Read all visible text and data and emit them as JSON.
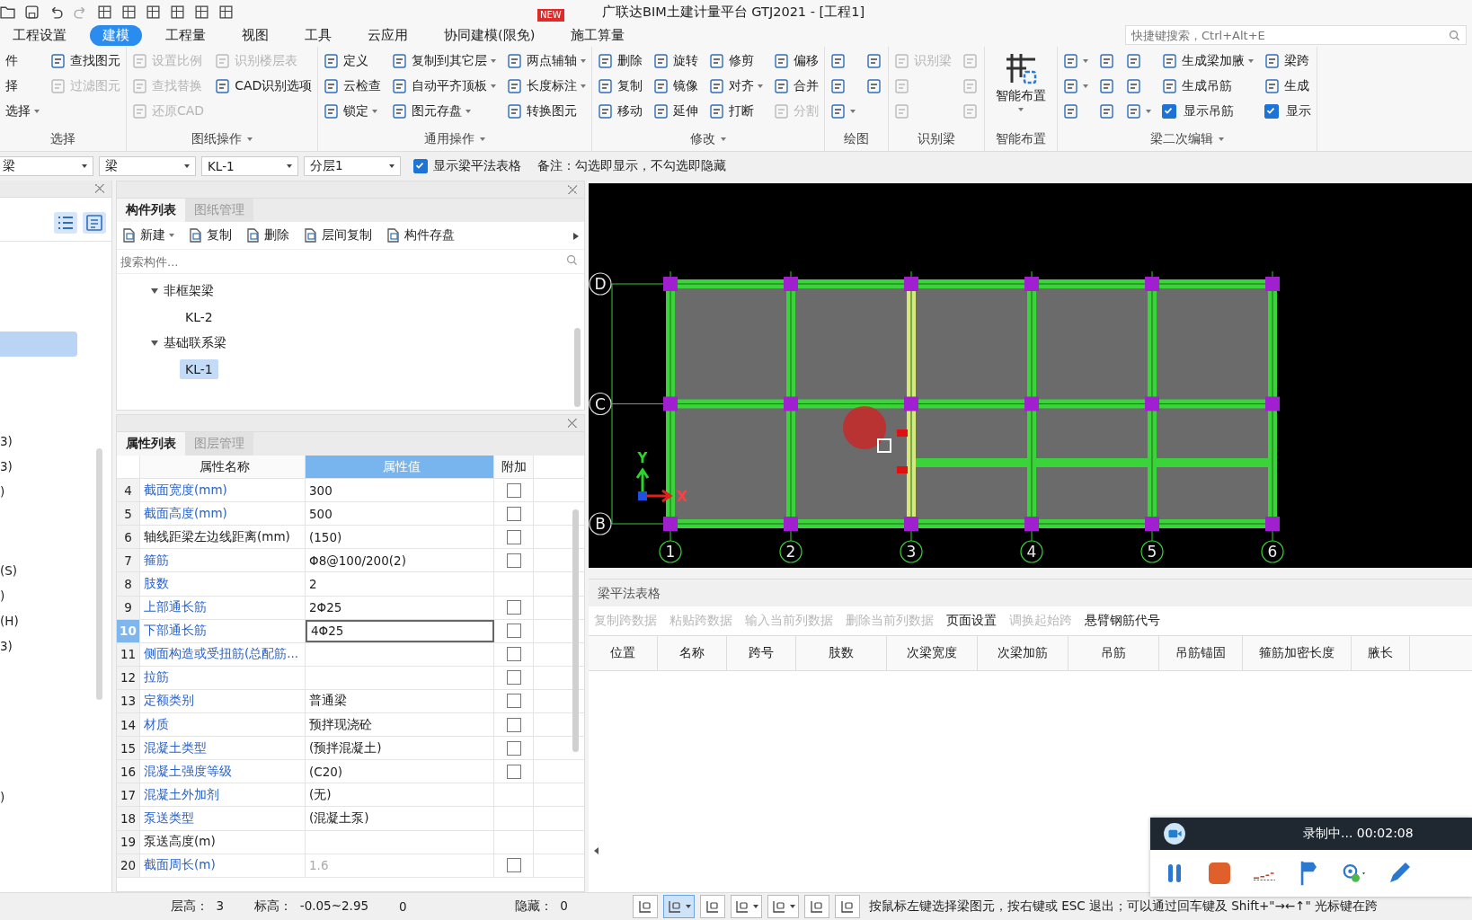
{
  "window": {
    "title": "广联达BIM土建计量平台 GTJ2021 - [工程1]",
    "badge": "NEW"
  },
  "menu_tabs": [
    {
      "label": "工程设置",
      "selected": false
    },
    {
      "label": "建模",
      "selected": true
    },
    {
      "label": "工程量",
      "selected": false
    },
    {
      "label": "视图",
      "selected": false
    },
    {
      "label": "工具",
      "selected": false
    },
    {
      "label": "云应用",
      "selected": false
    },
    {
      "label": "协同建模(限免)",
      "selected": false
    },
    {
      "label": "施工算量",
      "selected": false
    }
  ],
  "search": {
    "placeholder": "快捷键搜索，Ctrl+Alt+E"
  },
  "ribbon": {
    "groups": [
      {
        "label": "选择",
        "menu": false,
        "columns": [
          [
            {
              "kind": "text",
              "label": "件",
              "disabled": false
            },
            {
              "kind": "text",
              "label": "择",
              "disabled": false
            },
            {
              "kind": "text",
              "label": "选择",
              "menu": true,
              "disabled": false
            }
          ],
          [
            {
              "kind": "button",
              "label": "查找图元",
              "disabled": false
            },
            {
              "kind": "button",
              "label": "过滤图元",
              "disabled": true
            }
          ]
        ]
      },
      {
        "label": "图纸操作",
        "menu": true,
        "columns": [
          [
            {
              "kind": "button",
              "label": "设置比例",
              "disabled": true
            },
            {
              "kind": "button",
              "label": "查找替换",
              "disabled": true
            },
            {
              "kind": "button",
              "label": "还原CAD",
              "disabled": true
            }
          ],
          [
            {
              "kind": "button",
              "label": "识别楼层表",
              "disabled": true
            },
            {
              "kind": "button",
              "label": "CAD识别选项",
              "disabled": false
            }
          ]
        ]
      },
      {
        "label": "通用操作",
        "menu": true,
        "columns": [
          [
            {
              "kind": "button",
              "label": "定义",
              "disabled": false
            },
            {
              "kind": "button",
              "label": "云检查",
              "disabled": false
            },
            {
              "kind": "button",
              "label": "锁定",
              "menu": true,
              "disabled": false
            }
          ],
          [
            {
              "kind": "button",
              "label": "复制到其它层",
              "menu": true,
              "disabled": false
            },
            {
              "kind": "button",
              "label": "自动平齐顶板",
              "menu": true,
              "disabled": false
            },
            {
              "kind": "button",
              "label": "图元存盘",
              "menu": true,
              "disabled": false
            }
          ],
          [
            {
              "kind": "button",
              "label": "两点辅轴",
              "menu": true,
              "disabled": false
            },
            {
              "kind": "button",
              "label": "长度标注",
              "menu": true,
              "disabled": false
            },
            {
              "kind": "button",
              "label": "转换图元",
              "disabled": false
            }
          ]
        ]
      },
      {
        "label": "修改",
        "menu": true,
        "columns": [
          [
            {
              "kind": "button",
              "label": "删除",
              "disabled": false
            },
            {
              "kind": "button",
              "label": "复制",
              "disabled": false
            },
            {
              "kind": "button",
              "label": "移动",
              "disabled": false
            }
          ],
          [
            {
              "kind": "button",
              "label": "旋转",
              "disabled": false
            },
            {
              "kind": "button",
              "label": "镜像",
              "disabled": false
            },
            {
              "kind": "button",
              "label": "延伸",
              "disabled": false
            }
          ],
          [
            {
              "kind": "button",
              "label": "修剪",
              "disabled": false
            },
            {
              "kind": "button",
              "label": "对齐",
              "menu": true,
              "disabled": false
            },
            {
              "kind": "button",
              "label": "打断",
              "disabled": false
            }
          ],
          [
            {
              "kind": "button",
              "label": "偏移",
              "disabled": false
            },
            {
              "kind": "button",
              "label": "合并",
              "disabled": false
            },
            {
              "kind": "button",
              "label": "分割",
              "disabled": true
            }
          ]
        ]
      },
      {
        "label": "绘图",
        "menu": false,
        "columns": [
          [
            {
              "kind": "icon",
              "disabled": false
            },
            {
              "kind": "icon",
              "disabled": false
            },
            {
              "kind": "icon",
              "menu": true,
              "disabled": false
            }
          ],
          [
            {
              "kind": "icon",
              "disabled": false
            },
            {
              "kind": "icon",
              "disabled": false
            }
          ]
        ]
      },
      {
        "label": "识别梁",
        "menu": false,
        "columns": [
          [
            {
              "kind": "button",
              "label": "识别梁",
              "disabled": true
            },
            {
              "kind": "icon",
              "disabled": true
            },
            {
              "kind": "icon",
              "disabled": true
            }
          ],
          [
            {
              "kind": "icon",
              "disabled": true
            },
            {
              "kind": "icon",
              "disabled": true
            },
            {
              "kind": "icon",
              "disabled": true
            }
          ]
        ]
      },
      {
        "label": "智能布置",
        "menu": false,
        "columns": [
          [
            {
              "kind": "large",
              "label": "智能布置",
              "menu": true,
              "disabled": false
            }
          ]
        ]
      },
      {
        "label": "梁二次编辑",
        "menu": true,
        "columns": [
          [
            {
              "kind": "icon",
              "menu": true,
              "disabled": false
            },
            {
              "kind": "icon",
              "menu": true,
              "disabled": false
            },
            {
              "kind": "icon",
              "disabled": false
            }
          ],
          [
            {
              "kind": "icon",
              "disabled": false
            },
            {
              "kind": "icon",
              "disabled": false
            },
            {
              "kind": "icon",
              "disabled": false
            }
          ],
          [
            {
              "kind": "icon",
              "disabled": false
            },
            {
              "kind": "icon",
              "disabled": false
            },
            {
              "kind": "icon",
              "menu": true,
              "disabled": false
            }
          ],
          [
            {
              "kind": "button",
              "label": "生成梁加腋",
              "menu": true,
              "disabled": false
            },
            {
              "kind": "button",
              "label": "生成吊筋",
              "disabled": false
            },
            {
              "kind": "check",
              "label": "显示吊筋",
              "checked": true
            }
          ],
          [
            {
              "kind": "button",
              "label": "梁跨",
              "disabled": false
            },
            {
              "kind": "button",
              "label": "生成",
              "disabled": false
            },
            {
              "kind": "check",
              "label": "显示",
              "checked": true
            }
          ]
        ]
      }
    ]
  },
  "toolbar": {
    "selects": [
      "梁",
      "梁",
      "KL-1",
      "分层1"
    ],
    "checkbox": {
      "label": "显示梁平法表格",
      "checked": true
    },
    "note": "备注：勾选即显示，不勾选即隐藏"
  },
  "left_panel": {
    "groups": [
      [
        {
          "selected": true
        }
      ],
      [
        {
          "label": "3)",
          "selected": false
        },
        {
          "label": "3)",
          "selected": false
        },
        {
          "label": ")",
          "selected": false
        }
      ],
      [
        {
          "label": "(S)",
          "selected": false
        },
        {
          "label": ")",
          "selected": false
        },
        {
          "label": "(H)",
          "selected": false
        },
        {
          "label": "3)",
          "selected": false
        }
      ],
      [
        {
          "label": ")",
          "selected": false
        }
      ]
    ]
  },
  "component_panel": {
    "tabs": [
      {
        "label": "构件列表",
        "selected": true
      },
      {
        "label": "图纸管理",
        "selected": false
      }
    ],
    "actions": [
      {
        "label": "新建",
        "menu": true
      },
      {
        "label": "复制",
        "menu": false
      },
      {
        "label": "删除",
        "menu": false
      },
      {
        "label": "层间复制",
        "menu": false
      },
      {
        "label": "构件存盘",
        "menu": false
      }
    ],
    "search": {
      "placeholder": "搜索构件..."
    },
    "tree": [
      {
        "label": "非框架梁",
        "expanded": true,
        "children": [
          {
            "label": "KL-2",
            "selected": false
          }
        ]
      },
      {
        "label": "基础联系梁",
        "expanded": true,
        "children": [
          {
            "label": "KL-1",
            "selected": true
          }
        ]
      }
    ]
  },
  "property_panel": {
    "tabs": [
      {
        "label": "属性列表",
        "selected": true
      },
      {
        "label": "图层管理",
        "selected": false
      }
    ],
    "columns": [
      "属性名称",
      "属性值",
      "附加"
    ],
    "rows": [
      {
        "num": "4",
        "name": "截面宽度(mm)",
        "value": "300",
        "linked": true,
        "value_disabled": false,
        "selected": false,
        "extra": {
          "checked": false
        }
      },
      {
        "num": "5",
        "name": "截面高度(mm)",
        "value": "500",
        "linked": true,
        "value_disabled": false,
        "selected": false,
        "extra": {
          "checked": false
        }
      },
      {
        "num": "6",
        "name": "轴线距梁左边线距离(mm)",
        "value": "(150)",
        "linked": false,
        "value_disabled": false,
        "selected": false,
        "extra": {
          "checked": false
        }
      },
      {
        "num": "7",
        "name": "箍筋",
        "value": "Φ8@100/200(2)",
        "linked": true,
        "value_disabled": false,
        "selected": false,
        "extra": {
          "checked": false
        }
      },
      {
        "num": "8",
        "name": "肢数",
        "value": "2",
        "linked": true,
        "value_disabled": false,
        "selected": false
      },
      {
        "num": "9",
        "name": "上部通长筋",
        "value": "2Φ25",
        "linked": true,
        "value_disabled": false,
        "selected": false,
        "extra": {
          "checked": false
        }
      },
      {
        "num": "10",
        "name": "下部通长筋",
        "value": "4Φ25",
        "linked": true,
        "value_disabled": false,
        "selected": true,
        "extra": {
          "checked": false
        }
      },
      {
        "num": "11",
        "name": "侧面构造或受扭筋(总配筋...",
        "linked": true,
        "value_disabled": false,
        "selected": false,
        "extra": {
          "checked": false
        }
      },
      {
        "num": "12",
        "name": "拉筋",
        "linked": true,
        "value_disabled": false,
        "selected": false,
        "extra": {
          "checked": false
        }
      },
      {
        "num": "13",
        "name": "定额类别",
        "value": "普通梁",
        "linked": true,
        "value_disabled": false,
        "selected": false,
        "extra": {
          "checked": false
        }
      },
      {
        "num": "14",
        "name": "材质",
        "value": "预拌现浇砼",
        "linked": true,
        "value_disabled": false,
        "selected": false,
        "extra": {
          "checked": false
        }
      },
      {
        "num": "15",
        "name": "混凝土类型",
        "value": "(预拌混凝土)",
        "linked": true,
        "value_disabled": false,
        "selected": false,
        "extra": {
          "checked": false
        }
      },
      {
        "num": "16",
        "name": "混凝土强度等级",
        "value": "(C20)",
        "linked": true,
        "value_disabled": false,
        "selected": false,
        "extra": {
          "checked": false
        }
      },
      {
        "num": "17",
        "name": "混凝土外加剂",
        "value": "(无)",
        "linked": true,
        "value_disabled": false,
        "selected": false
      },
      {
        "num": "18",
        "name": "泵送类型",
        "value": "(混凝土泵)",
        "linked": true,
        "value_disabled": false,
        "selected": false
      },
      {
        "num": "19",
        "name": "泵送高度(m)",
        "linked": false,
        "value_disabled": false,
        "selected": false
      },
      {
        "num": "20",
        "name": "截面周长(m)",
        "value": "1.6",
        "linked": true,
        "value_disabled": true,
        "selected": false,
        "extra": {
          "checked": false
        }
      }
    ]
  },
  "canvas": {
    "rows": [
      "D",
      "C",
      "B"
    ],
    "columns": [
      "1",
      "2",
      "3",
      "4",
      "5",
      "6"
    ],
    "ucs": {
      "x": "X",
      "y": "Y"
    }
  },
  "rebar_table": {
    "title": "梁平法表格",
    "actions": [
      {
        "label": "复制跨数据",
        "disabled": true
      },
      {
        "label": "粘贴跨数据",
        "disabled": true
      },
      {
        "label": "输入当前列数据",
        "disabled": true
      },
      {
        "label": "删除当前列数据",
        "disabled": true
      },
      {
        "label": "页面设置",
        "disabled": false
      },
      {
        "label": "调换起始跨",
        "disabled": true
      },
      {
        "label": "悬臂钢筋代号",
        "disabled": false
      }
    ],
    "columns": [
      "位置",
      "名称",
      "跨号",
      "肢数",
      "次梁宽度",
      "次梁加筋",
      "吊筋",
      "吊筋锚固",
      "箍筋加密长度",
      "腋长"
    ]
  },
  "status_bar": {
    "fields": [
      {
        "label": "层高：",
        "value": "3"
      },
      {
        "label": "标高：",
        "value": "-0.05~2.95"
      },
      {
        "value": "0"
      },
      {
        "label": "隐藏：",
        "value": "0"
      }
    ],
    "tools": [
      {
        "selected": false,
        "menu": false
      },
      {
        "selected": true,
        "menu": true
      },
      {
        "selected": false,
        "menu": false
      },
      {
        "selected": false,
        "menu": true
      },
      {
        "selected": false,
        "menu": true
      },
      {
        "selected": false,
        "menu": false
      },
      {
        "selected": false,
        "menu": false
      }
    ],
    "message": "按鼠标左键选择梁图元，按右键或 ESC 退出；可以通过回车键及 Shift+\"→←↑\" 光标键在跨"
  },
  "recorder": {
    "status": "录制中... 00:02:08"
  }
}
